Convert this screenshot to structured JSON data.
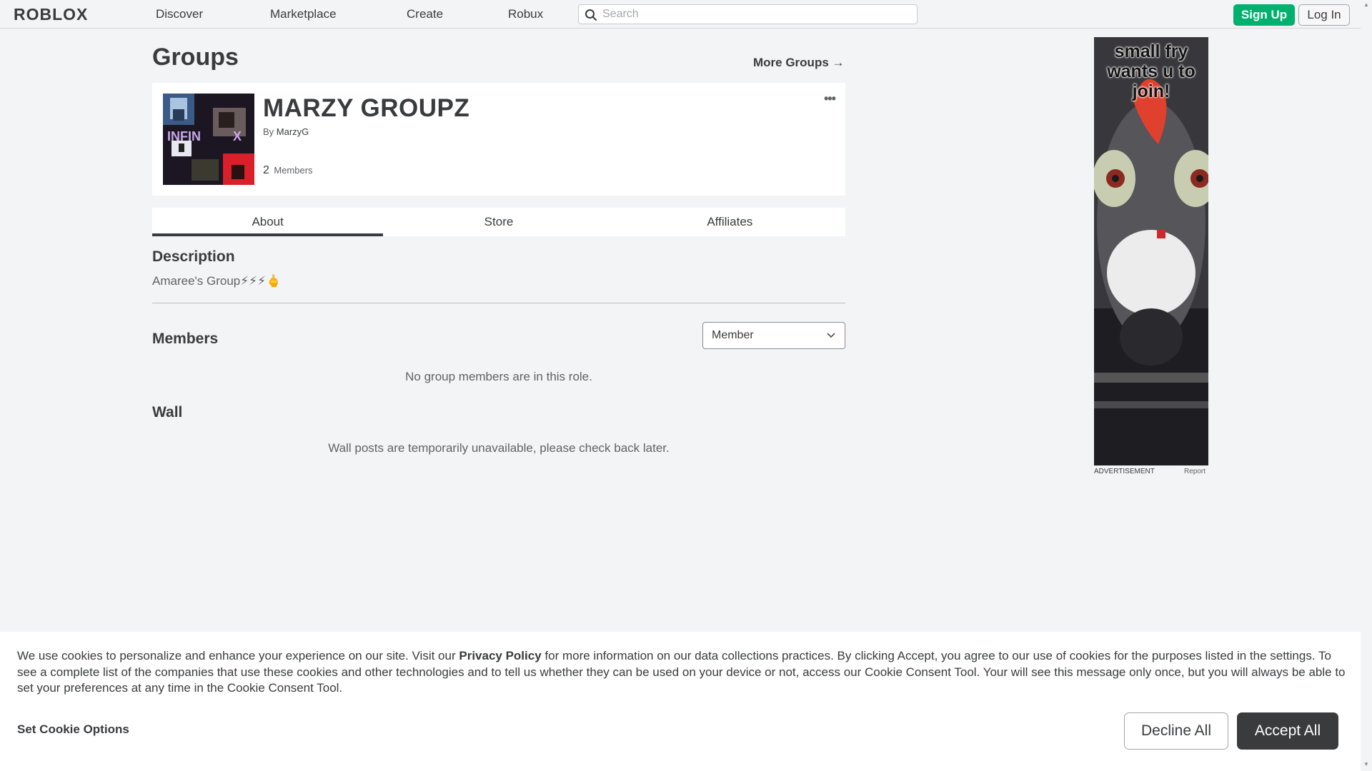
{
  "nav": {
    "logo": "ROBLOX",
    "links": [
      "Discover",
      "Marketplace",
      "Create",
      "Robux"
    ],
    "search_placeholder": "Search",
    "signup": "Sign Up",
    "login": "Log In"
  },
  "page": {
    "title": "Groups",
    "more_groups": "More Groups →"
  },
  "group": {
    "name": "MARZY GROUPZ",
    "by_prefix": "By",
    "owner": "MarzyG",
    "member_count": "2",
    "member_label": "Members",
    "more_icon": "ellipsis-icon"
  },
  "tabs": [
    "About",
    "Store",
    "Affiliates"
  ],
  "about": {
    "description_heading": "Description",
    "description": "Amaree's Group⚡⚡⚡🖕",
    "members_heading": "Members",
    "role_selected": "Member",
    "members_empty": "No group members are in this role.",
    "wall_heading": "Wall",
    "wall_empty": "Wall posts are temporarily unavailable, please check back later."
  },
  "ad": {
    "text": "small fry wants u to join!",
    "label": "ADVERTISEMENT",
    "report": "Report"
  },
  "cookie": {
    "text_before": "We use cookies to personalize and enhance your experience on our site. Visit our ",
    "privacy_link": "Privacy Policy",
    "text_after": " for more information on our data collections practices. By clicking Accept, you agree to our use of cookies for the purposes listed in the settings. To see a complete list of the companies that use these cookies and other technologies and to tell us whether they can be used on your device or not, access our Cookie Consent Tool. Your will see this message only once, but you will always be able to set your preferences at any time in the Cookie Consent Tool.",
    "options": "Set Cookie Options",
    "decline": "Decline All",
    "accept": "Accept All"
  },
  "colors": {
    "accent_green": "#00b06f",
    "text_dark": "#393b3d",
    "bg": "#f2f4f5"
  }
}
